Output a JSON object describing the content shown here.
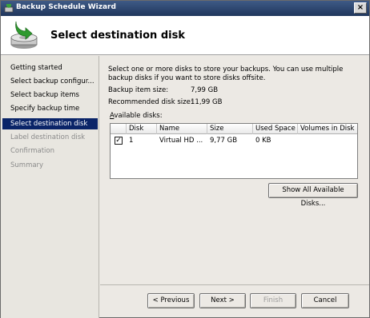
{
  "window": {
    "title": "Backup Schedule Wizard",
    "close": "×"
  },
  "header": {
    "title": "Select destination disk"
  },
  "nav": {
    "items": [
      {
        "label": "Getting started",
        "state": "normal"
      },
      {
        "label": "Select backup configur...",
        "state": "normal"
      },
      {
        "label": "Select backup items",
        "state": "normal"
      },
      {
        "label": "Specify backup time",
        "state": "normal"
      },
      {
        "label": "Select destination disk",
        "state": "active"
      },
      {
        "label": "Label destination disk",
        "state": "disabled"
      },
      {
        "label": "Confirmation",
        "state": "disabled"
      },
      {
        "label": "Summary",
        "state": "disabled"
      }
    ]
  },
  "content": {
    "intro": "Select one or more disks to store your backups. You can use multiple backup disks if you want to store disks offsite.",
    "backup_size_label": "Backup item size:",
    "backup_size_value": "7,99 GB",
    "recommended_label": "Recommended disk size:",
    "recommended_value": "11,99 GB",
    "available_prefix": "A",
    "available_rest": "vailable disks:"
  },
  "table": {
    "columns": [
      "Disk",
      "Name",
      "Size",
      "Used Space",
      "Volumes in Disk"
    ],
    "rows": [
      {
        "checked": "✓",
        "disk": "1",
        "name": "Virtual HD ...",
        "size": "9,77 GB",
        "used": "0 KB",
        "volumes": ""
      }
    ]
  },
  "buttons": {
    "show_all": "Show All Available Disks...",
    "previous": "< Previous",
    "next": "Next >",
    "finish": "Finish",
    "cancel": "Cancel"
  }
}
